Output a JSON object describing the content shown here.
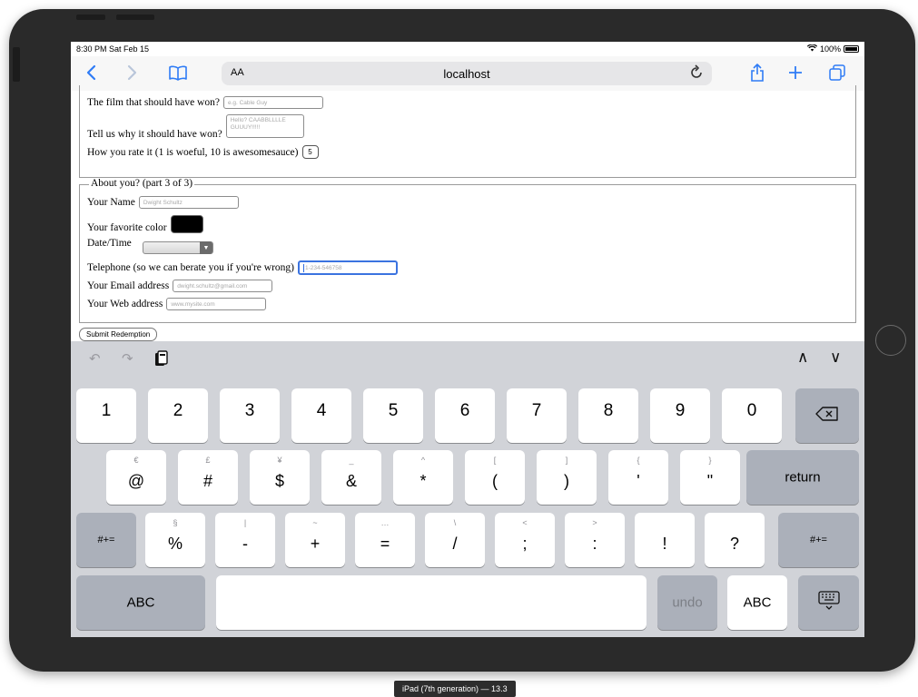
{
  "status_bar": {
    "time": "8:30 PM  Sat Feb 15",
    "wifi_icon": "wifi-icon",
    "battery": "100%"
  },
  "browser": {
    "text_size_label": "AA",
    "url": "localhost",
    "icons": [
      "back-icon",
      "forward-icon",
      "bookmarks-icon",
      "reload-icon",
      "share-icon",
      "new-tab-icon",
      "tabs-icon"
    ],
    "accent_color": "#2f7cf6"
  },
  "form": {
    "part2": {
      "film_label": "The film that should have won?",
      "film_placeholder": "e.g. Cable Guy",
      "why_label": "Tell us why it should have won?",
      "why_placeholder": "Hello? CAABBLLLLE GUUUY!!!!!",
      "rate_label": "How you rate it (1 is woeful, 10 is awesomesauce)",
      "rate_value": "5"
    },
    "part3": {
      "legend": "About you? (part 3 of 3)",
      "name_label": "Your Name",
      "name_placeholder": "Dwight Schultz",
      "color_label": "Your favorite color",
      "color_value": "#000000",
      "datetime_label": "Date/Time",
      "phone_label": "Telephone (so we can berate you if you're wrong)",
      "phone_placeholder": "1-234-546758",
      "email_label": "Your Email address",
      "email_placeholder": "dwight.schultz@gmail.com",
      "web_label": "Your Web address",
      "web_placeholder": "www.mysite.com"
    },
    "submit_label": "Submit Redemption"
  },
  "keyboard": {
    "accessory": {
      "undo_icon": "undo-icon",
      "redo_icon": "redo-icon",
      "paste_icon": "paste-icon",
      "up": "∧",
      "down": "∨"
    },
    "row1": [
      "1",
      "2",
      "3",
      "4",
      "5",
      "6",
      "7",
      "8",
      "9",
      "0"
    ],
    "delete_icon": "delete-icon",
    "row2": [
      {
        "alt": "€",
        "main": "@"
      },
      {
        "alt": "£",
        "main": "#"
      },
      {
        "alt": "¥",
        "main": "$"
      },
      {
        "alt": "_",
        "main": "&"
      },
      {
        "alt": "^",
        "main": "*"
      },
      {
        "alt": "[",
        "main": "("
      },
      {
        "alt": "]",
        "main": ")"
      },
      {
        "alt": "{",
        "main": "'"
      },
      {
        "alt": "}",
        "main": "\""
      }
    ],
    "return_label": "return",
    "shift_label": "#+=",
    "row3": [
      {
        "alt": "§",
        "main": "%"
      },
      {
        "alt": "|",
        "main": "-"
      },
      {
        "alt": "~",
        "main": "+"
      },
      {
        "alt": "…",
        "main": "="
      },
      {
        "alt": "\\",
        "main": "/"
      },
      {
        "alt": "<",
        "main": ";"
      },
      {
        "alt": ">",
        "main": ":"
      },
      {
        "alt": "",
        "main": "!"
      },
      {
        "alt": "",
        "main": "?"
      }
    ],
    "abc_label": "ABC",
    "undo_label": "undo",
    "hide_keyboard_icon": "keyboard-dismiss-icon"
  },
  "device_caption": "iPad (7th generation) — 13.3"
}
